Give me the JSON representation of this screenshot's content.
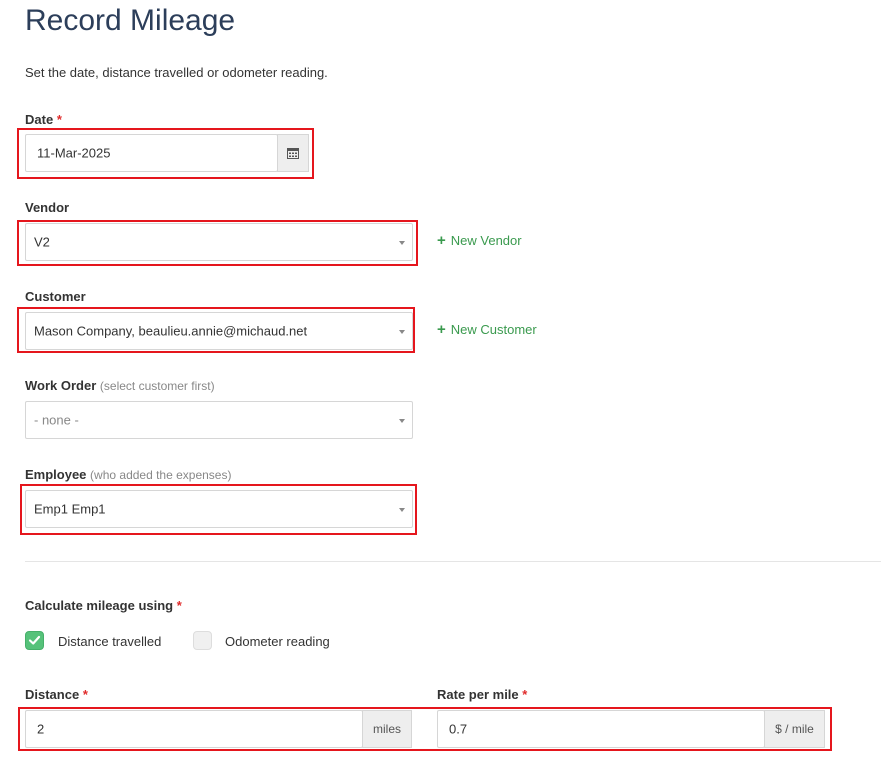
{
  "page": {
    "title": "Record Mileage",
    "subtitle": "Set the date, distance travelled or odometer reading."
  },
  "date": {
    "label": "Date",
    "required": "*",
    "value": "11-Mar-2025",
    "icon": "calendar-icon"
  },
  "vendor": {
    "label": "Vendor",
    "value": "V2",
    "new_label": "New Vendor"
  },
  "customer": {
    "label": "Customer",
    "value": "Mason Company, beaulieu.annie@michaud.net",
    "new_label": "New Customer"
  },
  "work_order": {
    "label": "Work Order",
    "hint": "(select customer first)",
    "value": "- none -"
  },
  "employee": {
    "label": "Employee",
    "hint": "(who added the expenses)",
    "value": "Emp1 Emp1"
  },
  "mileage_method": {
    "label": "Calculate mileage using",
    "required": "*",
    "options": [
      {
        "label": "Distance travelled",
        "checked": true
      },
      {
        "label": "Odometer reading",
        "checked": false
      }
    ]
  },
  "distance": {
    "label": "Distance",
    "required": "*",
    "value": "2",
    "unit": "miles"
  },
  "rate": {
    "label": "Rate per mile",
    "required": "*",
    "value": "0.7",
    "unit": "$ / mile"
  },
  "colors": {
    "highlight": "#e5161d",
    "accent_green": "#3a9a4e",
    "check_green": "#56c27a",
    "title": "#2c3e5a"
  }
}
